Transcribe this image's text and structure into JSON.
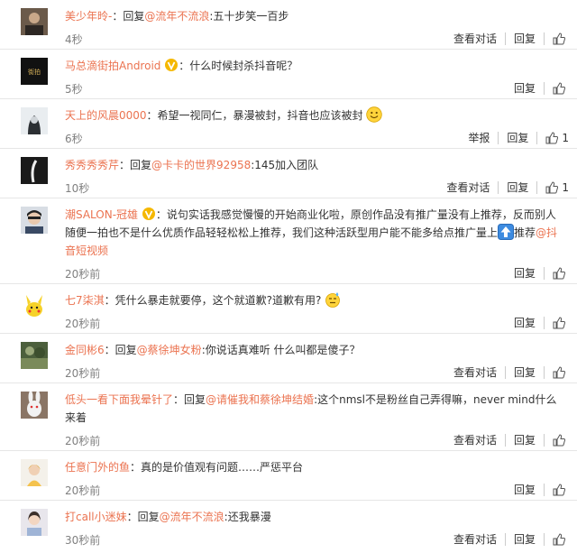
{
  "actions": {
    "view_conversation": "查看对话",
    "reply": "回复",
    "report": "举报"
  },
  "colors": {
    "username": "#eb7350",
    "meta": "#808080",
    "divider": "#e6e6e6"
  },
  "comments": [
    {
      "user": "美少年昤-",
      "reply_word": "回复",
      "mention": "@流年不流浪",
      "text": ":五十步笑一百步",
      "time": "4秒",
      "likes": ""
    },
    {
      "user": "马总滴街拍Android",
      "verified": true,
      "text": "：什么时候封杀抖音呢？",
      "time": "5秒",
      "likes": ""
    },
    {
      "user": "天上的风晨0000",
      "text": "：希望一视同仁，暴漫被封，抖音也应该被封",
      "emoji": "smile",
      "time": "6秒",
      "likes": "1"
    },
    {
      "user": "秀秀秀秀芹",
      "reply_word": "回复",
      "mention": "@卡卡的世界92958",
      "text": ":145加入团队",
      "time": "10秒",
      "likes": "1"
    },
    {
      "user": "潮SALON-冠雄",
      "verified": true,
      "text": "：说句实话我感觉慢慢的开始商业化啦，原创作品没有推广量没有上推荐，反而别人随便一拍也不是什么优质作品轻轻松松上推荐，我们这种活跃型用户能不能多给点推广量上",
      "text_after": "推荐",
      "mention_after": "@抖音短视频",
      "time": "20秒前",
      "likes": ""
    },
    {
      "user": "七7柒淇",
      "text": "：凭什么暴走就要停，这个就道歉?道歉有用?",
      "emoji": "sweat",
      "time": "20秒前",
      "likes": ""
    },
    {
      "user": "金同彬6",
      "reply_word": "回复",
      "mention": "@蔡徐坤女粉",
      "text": ":你说话真难听 什么叫都是傻子？",
      "time": "20秒前",
      "likes": ""
    },
    {
      "user": "低头一看下面我晕针了",
      "reply_word": "回复",
      "mention": "@请催我和蔡徐坤结婚",
      "text": ":这个nmsl不是粉丝自己弄得嘛，never mind什么来着",
      "time": "20秒前",
      "likes": ""
    },
    {
      "user": "任意门外的鱼",
      "text": "：真的是价值观有问题……严惩平台",
      "time": "20秒前",
      "likes": ""
    },
    {
      "user": "打call小迷妹",
      "reply_word": "回复",
      "mention": "@流年不流浪",
      "text": ":还我暴漫",
      "time": "30秒前",
      "likes": ""
    }
  ]
}
